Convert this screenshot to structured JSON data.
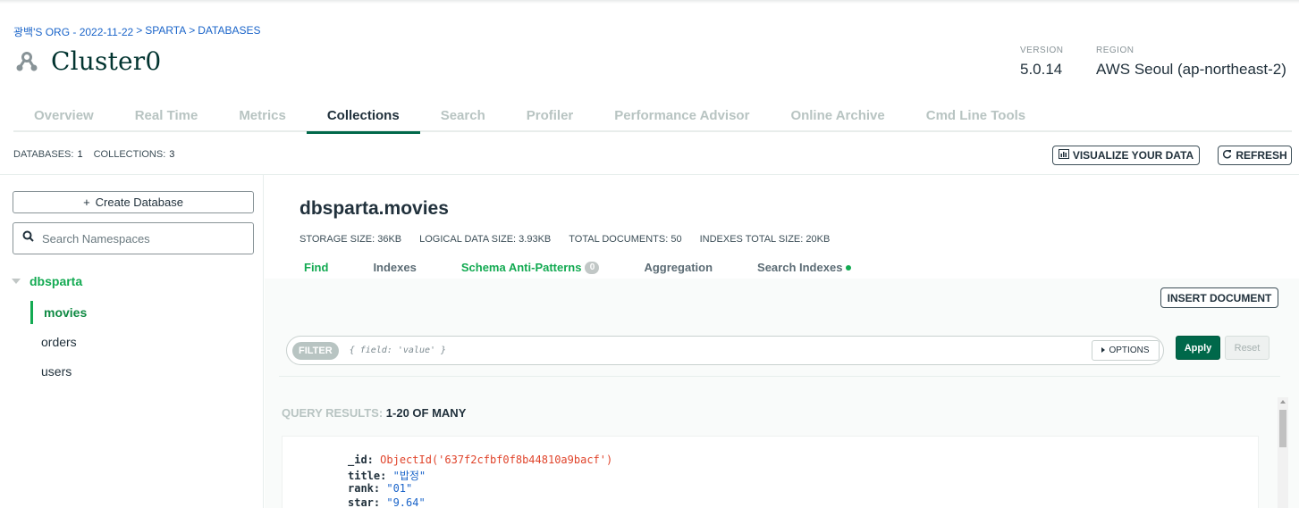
{
  "breadcrumb": [
    "광백'S ORG - 2022-11-22",
    "SPARTA",
    "DATABASES"
  ],
  "breadcrumb_sep": ">",
  "cluster": {
    "name": "Cluster0",
    "icon": "cluster-icon",
    "version_label": "VERSION",
    "version": "5.0.14",
    "region_label": "REGION",
    "region": "AWS Seoul (ap-northeast-2)"
  },
  "tabs": [
    {
      "label": "Overview",
      "active": false
    },
    {
      "label": "Real Time",
      "active": false
    },
    {
      "label": "Metrics",
      "active": false
    },
    {
      "label": "Collections",
      "active": true
    },
    {
      "label": "Search",
      "active": false
    },
    {
      "label": "Profiler",
      "active": false
    },
    {
      "label": "Performance Advisor",
      "active": false
    },
    {
      "label": "Online Archive",
      "active": false
    },
    {
      "label": "Cmd Line Tools",
      "active": false
    }
  ],
  "stats": {
    "databases_label": "DATABASES:",
    "databases": "1",
    "collections_label": "COLLECTIONS:",
    "collections": "3"
  },
  "toolbar": {
    "visualize_label": "VISUALIZE YOUR DATA",
    "refresh_label": "REFRESH"
  },
  "sidebar": {
    "create_label": "Create Database",
    "search_placeholder": "Search Namespaces",
    "database": "dbsparta",
    "collections": [
      {
        "name": "movies",
        "active": true
      },
      {
        "name": "orders",
        "active": false
      },
      {
        "name": "users",
        "active": false
      }
    ]
  },
  "namespace": {
    "title": "dbsparta.movies",
    "storage_size": "STORAGE SIZE: 36KB",
    "logical_size": "LOGICAL DATA SIZE: 3.93KB",
    "total_documents": "TOTAL DOCUMENTS: 50",
    "indexes_size": "INDEXES TOTAL SIZE: 20KB"
  },
  "subtabs": {
    "find": "Find",
    "indexes": "Indexes",
    "schema": "Schema Anti-Patterns",
    "schema_count": "0",
    "aggregation": "Aggregation",
    "search_indexes": "Search Indexes"
  },
  "query": {
    "insert_label": "INSERT DOCUMENT",
    "filter_label": "FILTER",
    "filter_placeholder": "{ field: 'value' }",
    "options_label": "OPTIONS",
    "apply_label": "Apply",
    "reset_label": "Reset",
    "results_label": "QUERY RESULTS:",
    "results_value": "1-20 OF MANY"
  },
  "document": {
    "id_key": "_id:",
    "id_value": "ObjectId('637f2cfbf0f8b44810a9bacf')",
    "title_key": "title:",
    "title_value": "\"밥정\"",
    "rank_key": "rank:",
    "rank_value": "\"01\"",
    "star_key": "star:",
    "star_value": "\"9.64\""
  },
  "colors": {
    "accent_green": "#00684a",
    "link_blue": "#1a64c9",
    "active_green": "#13aa52",
    "objectid_red": "#e0442b"
  }
}
